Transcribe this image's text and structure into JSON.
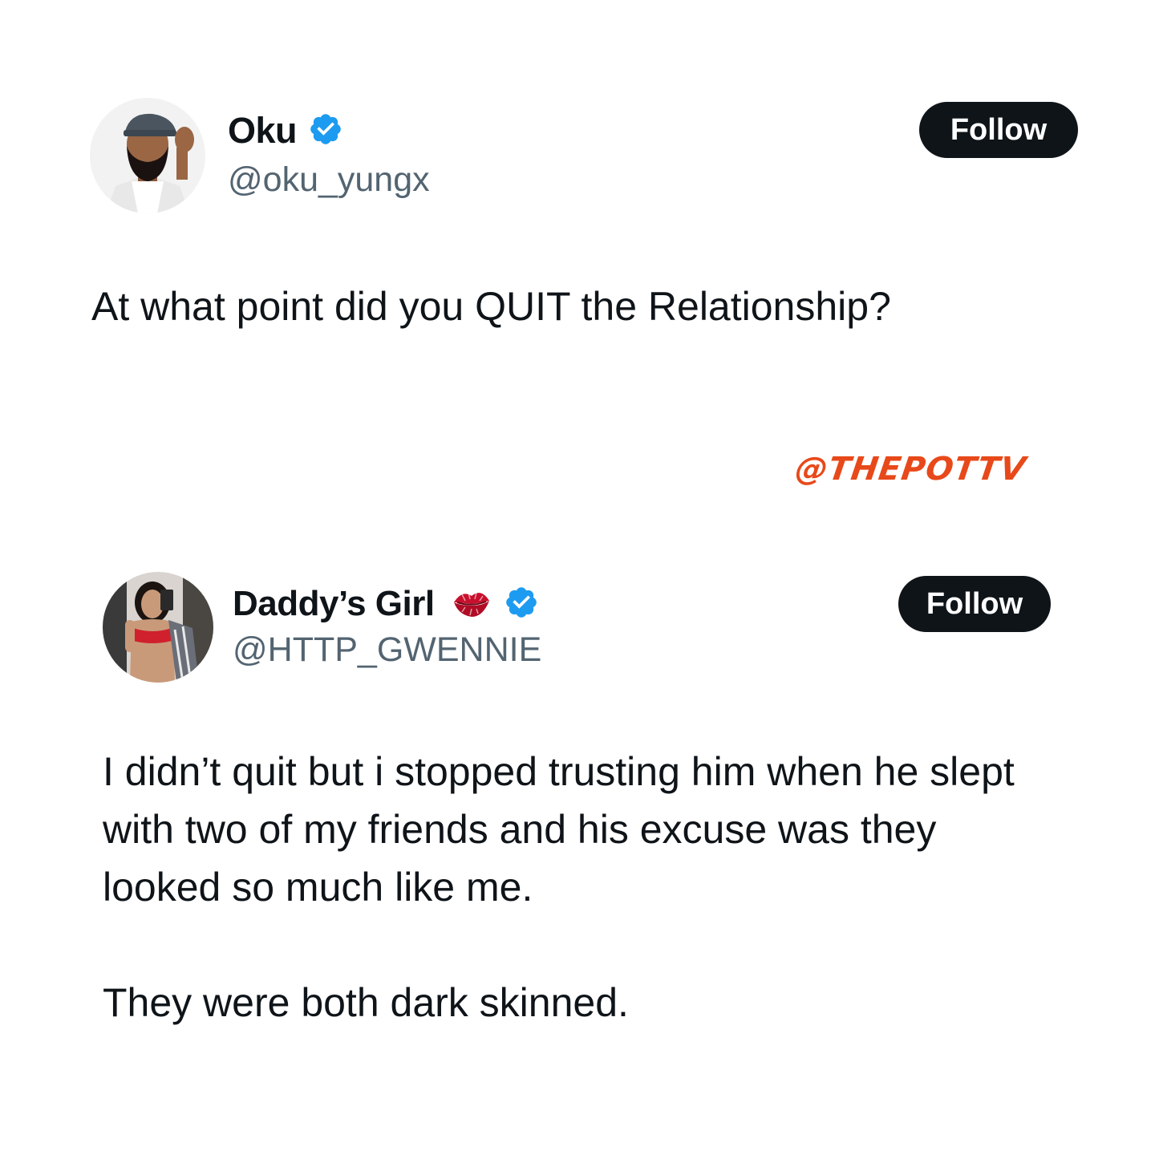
{
  "tweets": [
    {
      "display_name": "Oku",
      "handle": "@oku_yungx",
      "verified": true,
      "follow_label": "Follow",
      "text": [
        "At what point did you QUIT the Relationship?"
      ]
    },
    {
      "display_name": "Daddy’s Girl",
      "name_emoji": "kiss-lips-icon",
      "handle": "@HTTP_GWENNIE",
      "verified": true,
      "follow_label": "Follow",
      "text": [
        "I didn’t quit but i stopped trusting him when he slept with two of my friends and his excuse was they looked so much like me.",
        "They were both dark skinned."
      ]
    }
  ],
  "watermark": "@THEPOTTV",
  "colors": {
    "text": "#0f1419",
    "handle": "#536471",
    "verified": "#1d9bf0",
    "button_bg": "#0f1419",
    "button_text": "#ffffff",
    "watermark": "#e8491a",
    "lips": "#c8102e"
  }
}
